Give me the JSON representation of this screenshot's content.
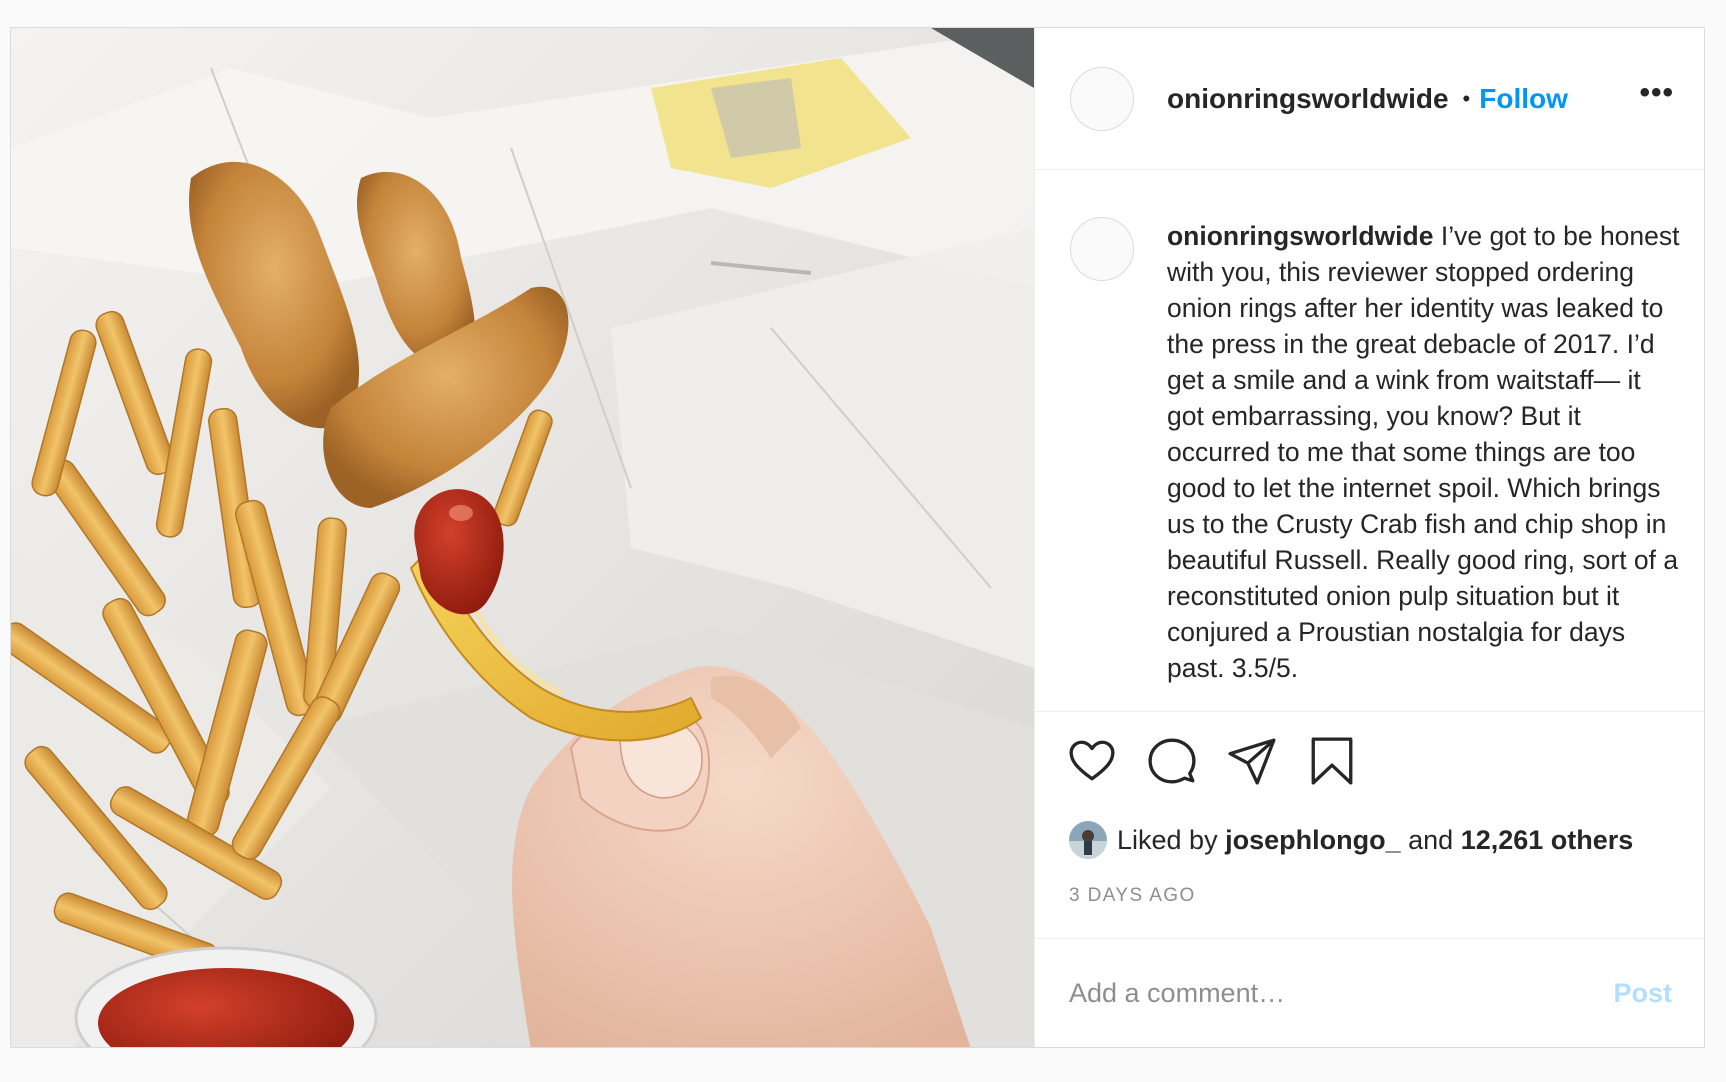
{
  "post": {
    "author": {
      "username": "onionringsworldwide",
      "follow_label": "Follow",
      "separator": "•",
      "more_label": "•••"
    },
    "image": {
      "description_icon": "photo"
    },
    "caption": {
      "username": "onionringsworldwide",
      "text": "I’ve got to be honest with you, this reviewer stopped ordering onion rings after her identity was leaked to the press in the great debacle of 2017. I’d get a smile and a wink from waitstaff— it got embarrassing, you know? But it occurred to me that some things are too good to let the internet spoil. Which brings us to the Crusty Crab fish and chip shop in beautiful Russell. Really good ring, sort of a reconstituted onion pulp situation but it conjured a Proustian nostalgia for days past. 3.5/5."
    },
    "actions": {
      "like_icon": "heart-icon",
      "comment_icon": "comment-icon",
      "share_icon": "share-icon",
      "save_icon": "bookmark-icon"
    },
    "likes": {
      "prefix": "Liked by",
      "liker": "josephlongo_",
      "middle": "and",
      "count_text": "12,261 others"
    },
    "timestamp": "3 DAYS AGO",
    "comment": {
      "placeholder": "Add a comment…",
      "post_label": "Post"
    }
  },
  "colors": {
    "accent": "#0095f6",
    "post_disabled": "#b2dffc",
    "muted": "#8e8e8e",
    "text": "#262626"
  }
}
